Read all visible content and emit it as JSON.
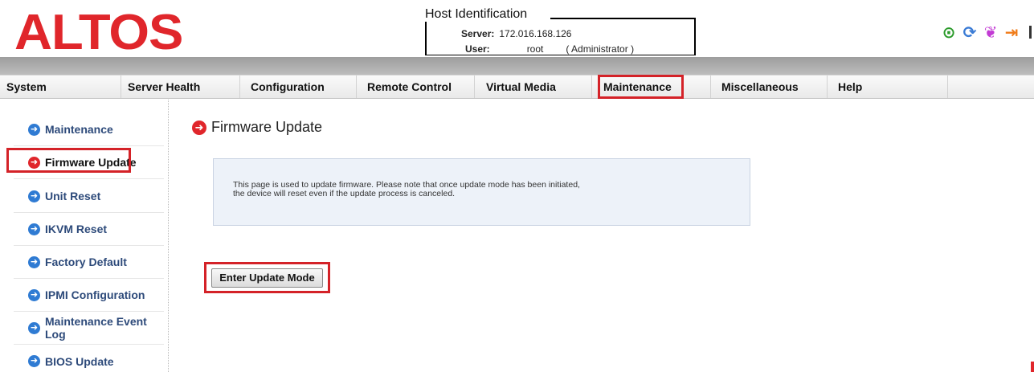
{
  "header": {
    "logo": "ALTOS",
    "host": {
      "title": "Host Identification",
      "server_label": "Server:",
      "server_value": "172.016.168.126",
      "user_label": "User:",
      "user_value": "root",
      "user_role": "( Administrator )"
    },
    "icons": [
      "check-circle-icon",
      "refresh-icon",
      "leaf-icon",
      "logout-icon"
    ]
  },
  "nav": {
    "items": [
      {
        "label": "System"
      },
      {
        "label": "Server Health"
      },
      {
        "label": "Configuration"
      },
      {
        "label": "Remote Control"
      },
      {
        "label": "Virtual Media"
      },
      {
        "label": "Maintenance"
      },
      {
        "label": "Miscellaneous"
      },
      {
        "label": "Help"
      }
    ],
    "active": "Maintenance"
  },
  "sidebar": {
    "items": [
      {
        "label": "Maintenance"
      },
      {
        "label": "Firmware Update"
      },
      {
        "label": "Unit Reset"
      },
      {
        "label": "IKVM Reset"
      },
      {
        "label": "Factory Default"
      },
      {
        "label": "IPMI Configuration"
      },
      {
        "label": "Maintenance Event Log"
      },
      {
        "label": "BIOS Update"
      }
    ],
    "active": "Firmware Update"
  },
  "main": {
    "title": "Firmware Update",
    "info_line1": "This page is used to update firmware. Please note that once update mode has been initiated,",
    "info_line2": "the device will reset even if the update process is canceled.",
    "button_label": "Enter Update Mode"
  },
  "colors": {
    "brand_red": "#e0262b",
    "highlight_red": "#d42228",
    "link_blue": "#2d4a7a",
    "arrow_blue": "#2f7bd3",
    "info_bg": "#edf2f9"
  }
}
